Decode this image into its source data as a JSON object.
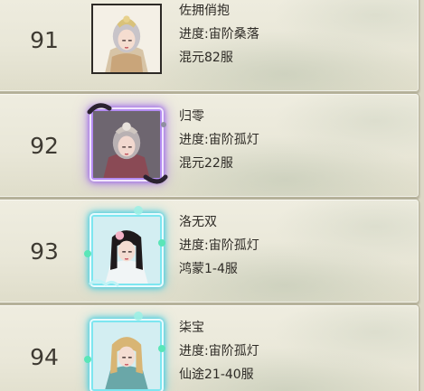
{
  "rows": [
    {
      "rank": "91",
      "name": "佐拥俏抱",
      "progress": "进度:宙阶桑落",
      "server": "混元82服",
      "frame": "plain"
    },
    {
      "rank": "92",
      "name": "归零",
      "progress": "进度:宙阶孤灯",
      "server": "混元22服",
      "frame": "purple"
    },
    {
      "rank": "93",
      "name": "洛无双",
      "progress": "进度:宙阶孤灯",
      "server": "鸿蒙1-4服",
      "frame": "cyan"
    },
    {
      "rank": "94",
      "name": "柒宝",
      "progress": "进度:宙阶孤灯",
      "server": "仙途21-40服",
      "frame": "cyan"
    }
  ]
}
